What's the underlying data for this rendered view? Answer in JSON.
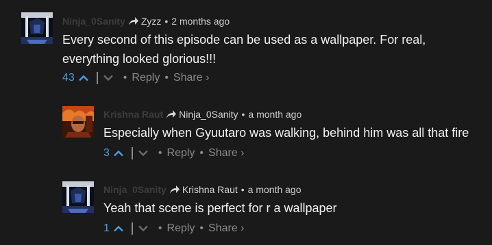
{
  "colors": {
    "background": "#1a1a1a",
    "author": "#3d3d3d",
    "count": "#4a9ee8",
    "muted": "#8a8a8a",
    "text": "#f2f2f2"
  },
  "comments": [
    {
      "author": "Ninja_0Sanity",
      "reply_to": "Zyzz",
      "time": "2 months ago",
      "body_line1": "Every second of this episode can be used as a wallpaper. For real,",
      "body_line2": "everything looked glorious!!!",
      "upvotes": "43",
      "reply_label": "Reply",
      "share_label": "Share ›",
      "avatar_icon": "ninja-avatar"
    },
    {
      "author": "Krishna Raut",
      "reply_to": "Ninja_0Sanity",
      "time": "a month ago",
      "body_line1": "Especially when Gyuutaro was walking, behind him was all that fire",
      "upvotes": "3",
      "reply_label": "Reply",
      "share_label": "Share ›",
      "avatar_icon": "fire-avatar"
    },
    {
      "author": "Ninja_0Sanity",
      "reply_to": "Krishna Raut",
      "time": "a month ago",
      "body_line1": "Yeah that scene is perfect for r a wallpaper",
      "upvotes": "1",
      "reply_label": "Reply",
      "share_label": "Share ›",
      "avatar_icon": "ninja-avatar"
    }
  ],
  "separator_dot": "•"
}
